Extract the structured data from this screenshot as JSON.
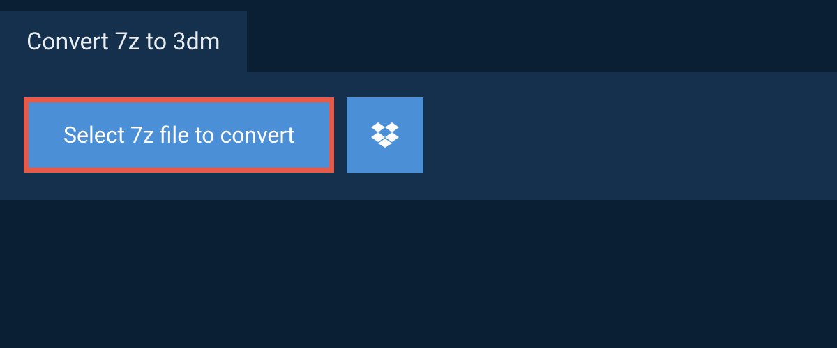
{
  "header": {
    "title": "Convert 7z to 3dm"
  },
  "actions": {
    "select_file_label": "Select 7z file to convert",
    "dropbox_icon": "dropbox-icon"
  },
  "colors": {
    "background": "#0a1f33",
    "panel": "#15304d",
    "button_primary": "#4b8fd6",
    "button_border_highlight": "#e85a47",
    "text_light": "#e8edf2"
  }
}
